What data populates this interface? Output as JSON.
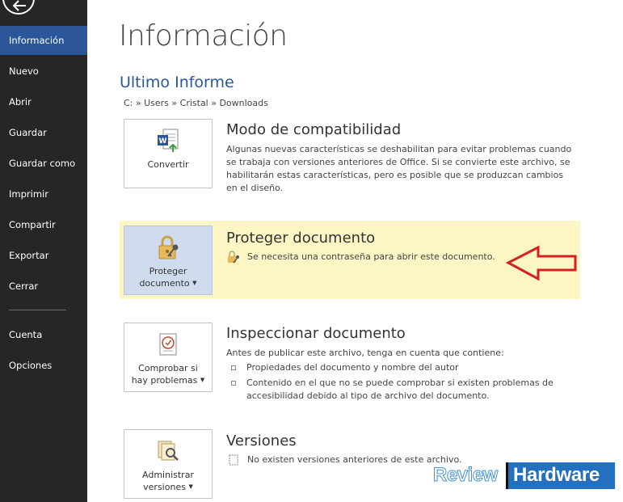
{
  "sidebar": {
    "items": [
      {
        "id": "informacion",
        "label": "Información",
        "active": true
      },
      {
        "id": "nuevo",
        "label": "Nuevo"
      },
      {
        "id": "abrir",
        "label": "Abrir"
      },
      {
        "id": "guardar",
        "label": "Guardar"
      },
      {
        "id": "guardar-como",
        "label": "Guardar como"
      },
      {
        "id": "imprimir",
        "label": "Imprimir"
      },
      {
        "id": "compartir",
        "label": "Compartir"
      },
      {
        "id": "exportar",
        "label": "Exportar"
      },
      {
        "id": "cerrar",
        "label": "Cerrar"
      },
      {
        "id": "cuenta",
        "label": "Cuenta"
      },
      {
        "id": "opciones",
        "label": "Opciones"
      }
    ],
    "accent": "#2b579a",
    "background": "#262626"
  },
  "main": {
    "title": "Información",
    "doc_name": "Ultimo Informe",
    "path": "C: » Users » Cristal » Downloads",
    "sections": {
      "compat": {
        "button_label": "Convertir",
        "title": "Modo de compatibilidad",
        "text": "Algunas nuevas características se deshabilitan para evitar problemas cuando se trabaja con versiones anteriores de Office. Si se convierte este archivo, se habilitarán estas características, pero es posible que se produzcan cambios en el diseño."
      },
      "protect": {
        "button_label": "Proteger documento",
        "button_line1": "Proteger",
        "button_line2": "documento",
        "title": "Proteger documento",
        "status": "Se necesita una contraseña para abrir este documento.",
        "highlight_color": "#fcf6c4"
      },
      "inspect": {
        "button_line1": "Comprobar si",
        "button_line2": "hay problemas",
        "title": "Inspeccionar documento",
        "intro": "Antes de publicar este archivo, tenga en cuenta que contiene:",
        "bullets": [
          "Propiedades del documento y nombre del autor",
          "Contenido en el que no se puede comprobar si existen problemas de accesibilidad debido al tipo de archivo del documento."
        ]
      },
      "versions": {
        "button_line1": "Administrar",
        "button_line2": "versiones",
        "title": "Versiones",
        "text": "No existen versiones anteriores de este archivo."
      }
    }
  },
  "icons": {
    "back": "back-arrow-icon",
    "convert": "word-convert-icon",
    "protect": "lock-key-icon",
    "inspect": "document-check-icon",
    "versions": "document-search-icon",
    "arrow": "red-arrow-icon"
  },
  "watermark": {
    "part1": "Review",
    "part2": "Hardware"
  }
}
